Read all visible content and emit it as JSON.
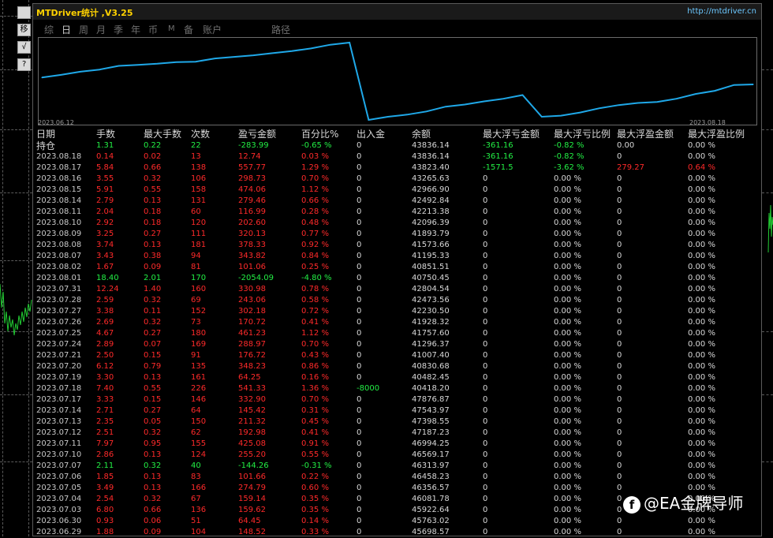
{
  "title": "MTDriver统计 ,V3.25",
  "url": "http://mtdriver.cn",
  "side_buttons": [
    "移",
    "√",
    "?"
  ],
  "tabs": [
    {
      "label": "综",
      "active": false
    },
    {
      "label": "日",
      "active": true
    },
    {
      "label": "周",
      "active": false
    },
    {
      "label": "月",
      "active": false
    },
    {
      "label": "季",
      "active": false
    },
    {
      "label": "年",
      "active": false
    },
    {
      "label": "币",
      "active": false
    },
    {
      "label": "M",
      "active": false
    },
    {
      "label": "备",
      "active": false
    },
    {
      "label": "账户",
      "active": false
    },
    {
      "label": "路径",
      "active": false
    }
  ],
  "chart_data": {
    "type": "line",
    "x_start_label": "2023.06.12",
    "x_end_label": "2023.08.18",
    "line_color": "#1fa8e8",
    "x": [
      "2023.06.12",
      "2023.06.19",
      "2023.06.26",
      "2023.06.29",
      "2023.06.30",
      "2023.07.03",
      "2023.07.04",
      "2023.07.05",
      "2023.07.06",
      "2023.07.07",
      "2023.07.10",
      "2023.07.11",
      "2023.07.12",
      "2023.07.13",
      "2023.07.14",
      "2023.07.17",
      "2023.07.18",
      "2023.07.19",
      "2023.07.20",
      "2023.07.21",
      "2023.07.24",
      "2023.07.25",
      "2023.07.26",
      "2023.07.27",
      "2023.07.28",
      "2023.07.31",
      "2023.08.01",
      "2023.08.02",
      "2023.08.07",
      "2023.08.08",
      "2023.08.09",
      "2023.08.10",
      "2023.08.11",
      "2023.08.14",
      "2023.08.15",
      "2023.08.16",
      "2023.08.17",
      "2023.08.18"
    ],
    "values": [
      44500,
      44750,
      45050,
      45250,
      45600,
      45700,
      45800,
      45950,
      46000,
      46300,
      46450,
      46600,
      46800,
      47000,
      47250,
      47600,
      47800,
      40500,
      40800,
      41000,
      41300,
      41750,
      41950,
      42250,
      42500,
      42850,
      40800,
      40900,
      41200,
      41600,
      41900,
      42100,
      42200,
      42500,
      42950,
      43250,
      43800,
      43850
    ]
  },
  "table": {
    "headers": [
      "日期",
      "手数",
      "最大手数",
      "次数",
      "盈亏金额",
      "百分比%",
      "出入金",
      "余额",
      "最大浮亏金额",
      "最大浮亏比例",
      "最大浮盈金额",
      "最大浮盈比例"
    ],
    "rows": [
      {
        "date": "持仓",
        "lots": "1.31",
        "max_lots": "0.22",
        "count": "22",
        "pl": "-283.99",
        "pct": "-0.65 %",
        "io": "0",
        "balance": "43836.14",
        "max_loss": "-361.16",
        "max_loss_pct": "-0.82 %",
        "max_gain": "0.00",
        "max_gain_pct": "0.00 %",
        "color": "g",
        "gain_color": "w"
      },
      {
        "date": "2023.08.18",
        "lots": "0.14",
        "max_lots": "0.02",
        "count": "13",
        "pl": "12.74",
        "pct": "0.03 %",
        "io": "0",
        "balance": "43836.14",
        "max_loss": "-361.16",
        "max_loss_pct": "-0.82 %",
        "max_gain": "0",
        "max_gain_pct": "0.00 %",
        "color": "r",
        "gain_color": "w"
      },
      {
        "date": "2023.08.17",
        "lots": "5.84",
        "max_lots": "0.66",
        "count": "138",
        "pl": "557.77",
        "pct": "1.29 %",
        "io": "0",
        "balance": "43823.40",
        "max_loss": "-1571.5",
        "max_loss_pct": "-3.62 %",
        "max_gain": "279.27",
        "max_gain_pct": "0.64 %",
        "color": "r",
        "gain_color": "r"
      },
      {
        "date": "2023.08.16",
        "lots": "3.55",
        "max_lots": "0.32",
        "count": "106",
        "pl": "298.73",
        "pct": "0.70 %",
        "io": "0",
        "balance": "43265.63",
        "max_loss": "0",
        "max_loss_pct": "0.00 %",
        "max_gain": "0",
        "max_gain_pct": "0.00 %",
        "color": "r",
        "gain_color": "w"
      },
      {
        "date": "2023.08.15",
        "lots": "5.91",
        "max_lots": "0.55",
        "count": "158",
        "pl": "474.06",
        "pct": "1.12 %",
        "io": "0",
        "balance": "42966.90",
        "max_loss": "0",
        "max_loss_pct": "0.00 %",
        "max_gain": "0",
        "max_gain_pct": "0.00 %",
        "color": "r",
        "gain_color": "w"
      },
      {
        "date": "2023.08.14",
        "lots": "2.79",
        "max_lots": "0.13",
        "count": "131",
        "pl": "279.46",
        "pct": "0.66 %",
        "io": "0",
        "balance": "42492.84",
        "max_loss": "0",
        "max_loss_pct": "0.00 %",
        "max_gain": "0",
        "max_gain_pct": "0.00 %",
        "color": "r",
        "gain_color": "w"
      },
      {
        "date": "2023.08.11",
        "lots": "2.04",
        "max_lots": "0.18",
        "count": "60",
        "pl": "116.99",
        "pct": "0.28 %",
        "io": "0",
        "balance": "42213.38",
        "max_loss": "0",
        "max_loss_pct": "0.00 %",
        "max_gain": "0",
        "max_gain_pct": "0.00 %",
        "color": "r",
        "gain_color": "w"
      },
      {
        "date": "2023.08.10",
        "lots": "2.92",
        "max_lots": "0.18",
        "count": "120",
        "pl": "202.60",
        "pct": "0.48 %",
        "io": "0",
        "balance": "42096.39",
        "max_loss": "0",
        "max_loss_pct": "0.00 %",
        "max_gain": "0",
        "max_gain_pct": "0.00 %",
        "color": "r",
        "gain_color": "w"
      },
      {
        "date": "2023.08.09",
        "lots": "3.25",
        "max_lots": "0.27",
        "count": "111",
        "pl": "320.13",
        "pct": "0.77 %",
        "io": "0",
        "balance": "41893.79",
        "max_loss": "0",
        "max_loss_pct": "0.00 %",
        "max_gain": "0",
        "max_gain_pct": "0.00 %",
        "color": "r",
        "gain_color": "w"
      },
      {
        "date": "2023.08.08",
        "lots": "3.74",
        "max_lots": "0.13",
        "count": "181",
        "pl": "378.33",
        "pct": "0.92 %",
        "io": "0",
        "balance": "41573.66",
        "max_loss": "0",
        "max_loss_pct": "0.00 %",
        "max_gain": "0",
        "max_gain_pct": "0.00 %",
        "color": "r",
        "gain_color": "w"
      },
      {
        "date": "2023.08.07",
        "lots": "3.43",
        "max_lots": "0.38",
        "count": "94",
        "pl": "343.82",
        "pct": "0.84 %",
        "io": "0",
        "balance": "41195.33",
        "max_loss": "0",
        "max_loss_pct": "0.00 %",
        "max_gain": "0",
        "max_gain_pct": "0.00 %",
        "color": "r",
        "gain_color": "w"
      },
      {
        "date": "2023.08.02",
        "lots": "1.67",
        "max_lots": "0.09",
        "count": "81",
        "pl": "101.06",
        "pct": "0.25 %",
        "io": "0",
        "balance": "40851.51",
        "max_loss": "0",
        "max_loss_pct": "0.00 %",
        "max_gain": "0",
        "max_gain_pct": "0.00 %",
        "color": "r",
        "gain_color": "w"
      },
      {
        "date": "2023.08.01",
        "lots": "18.40",
        "max_lots": "2.01",
        "count": "170",
        "pl": "-2054.09",
        "pct": "-4.80 %",
        "io": "0",
        "balance": "40750.45",
        "max_loss": "0",
        "max_loss_pct": "0.00 %",
        "max_gain": "0",
        "max_gain_pct": "0.00 %",
        "color": "g",
        "gain_color": "w"
      },
      {
        "date": "2023.07.31",
        "lots": "12.24",
        "max_lots": "1.40",
        "count": "160",
        "pl": "330.98",
        "pct": "0.78 %",
        "io": "0",
        "balance": "42804.54",
        "max_loss": "0",
        "max_loss_pct": "0.00 %",
        "max_gain": "0",
        "max_gain_pct": "0.00 %",
        "color": "r",
        "gain_color": "w"
      },
      {
        "date": "2023.07.28",
        "lots": "2.59",
        "max_lots": "0.32",
        "count": "69",
        "pl": "243.06",
        "pct": "0.58 %",
        "io": "0",
        "balance": "42473.56",
        "max_loss": "0",
        "max_loss_pct": "0.00 %",
        "max_gain": "0",
        "max_gain_pct": "0.00 %",
        "color": "r",
        "gain_color": "w"
      },
      {
        "date": "2023.07.27",
        "lots": "3.38",
        "max_lots": "0.11",
        "count": "152",
        "pl": "302.18",
        "pct": "0.72 %",
        "io": "0",
        "balance": "42230.50",
        "max_loss": "0",
        "max_loss_pct": "0.00 %",
        "max_gain": "0",
        "max_gain_pct": "0.00 %",
        "color": "r",
        "gain_color": "w"
      },
      {
        "date": "2023.07.26",
        "lots": "2.69",
        "max_lots": "0.32",
        "count": "73",
        "pl": "170.72",
        "pct": "0.41 %",
        "io": "0",
        "balance": "41928.32",
        "max_loss": "0",
        "max_loss_pct": "0.00 %",
        "max_gain": "0",
        "max_gain_pct": "0.00 %",
        "color": "r",
        "gain_color": "w"
      },
      {
        "date": "2023.07.25",
        "lots": "4.67",
        "max_lots": "0.27",
        "count": "180",
        "pl": "461.23",
        "pct": "1.12 %",
        "io": "0",
        "balance": "41757.60",
        "max_loss": "0",
        "max_loss_pct": "0.00 %",
        "max_gain": "0",
        "max_gain_pct": "0.00 %",
        "color": "r",
        "gain_color": "w"
      },
      {
        "date": "2023.07.24",
        "lots": "2.89",
        "max_lots": "0.07",
        "count": "169",
        "pl": "288.97",
        "pct": "0.70 %",
        "io": "0",
        "balance": "41296.37",
        "max_loss": "0",
        "max_loss_pct": "0.00 %",
        "max_gain": "0",
        "max_gain_pct": "0.00 %",
        "color": "r",
        "gain_color": "w"
      },
      {
        "date": "2023.07.21",
        "lots": "2.50",
        "max_lots": "0.15",
        "count": "91",
        "pl": "176.72",
        "pct": "0.43 %",
        "io": "0",
        "balance": "41007.40",
        "max_loss": "0",
        "max_loss_pct": "0.00 %",
        "max_gain": "0",
        "max_gain_pct": "0.00 %",
        "color": "r",
        "gain_color": "w"
      },
      {
        "date": "2023.07.20",
        "lots": "6.12",
        "max_lots": "0.79",
        "count": "135",
        "pl": "348.23",
        "pct": "0.86 %",
        "io": "0",
        "balance": "40830.68",
        "max_loss": "0",
        "max_loss_pct": "0.00 %",
        "max_gain": "0",
        "max_gain_pct": "0.00 %",
        "color": "r",
        "gain_color": "w"
      },
      {
        "date": "2023.07.19",
        "lots": "3.30",
        "max_lots": "0.13",
        "count": "161",
        "pl": "64.25",
        "pct": "0.16 %",
        "io": "0",
        "balance": "40482.45",
        "max_loss": "0",
        "max_loss_pct": "0.00 %",
        "max_gain": "0",
        "max_gain_pct": "0.00 %",
        "color": "r",
        "gain_color": "w"
      },
      {
        "date": "2023.07.18",
        "lots": "7.40",
        "max_lots": "0.55",
        "count": "226",
        "pl": "541.33",
        "pct": "1.36 %",
        "io": "-8000",
        "balance": "40418.20",
        "max_loss": "0",
        "max_loss_pct": "0.00 %",
        "max_gain": "0",
        "max_gain_pct": "0.00 %",
        "color": "r",
        "gain_color": "w",
        "io_color": "g"
      },
      {
        "date": "2023.07.17",
        "lots": "3.33",
        "max_lots": "0.15",
        "count": "146",
        "pl": "332.90",
        "pct": "0.70 %",
        "io": "0",
        "balance": "47876.87",
        "max_loss": "0",
        "max_loss_pct": "0.00 %",
        "max_gain": "0",
        "max_gain_pct": "0.00 %",
        "color": "r",
        "gain_color": "w"
      },
      {
        "date": "2023.07.14",
        "lots": "2.71",
        "max_lots": "0.27",
        "count": "64",
        "pl": "145.42",
        "pct": "0.31 %",
        "io": "0",
        "balance": "47543.97",
        "max_loss": "0",
        "max_loss_pct": "0.00 %",
        "max_gain": "0",
        "max_gain_pct": "0.00 %",
        "color": "r",
        "gain_color": "w"
      },
      {
        "date": "2023.07.13",
        "lots": "2.35",
        "max_lots": "0.05",
        "count": "150",
        "pl": "211.32",
        "pct": "0.45 %",
        "io": "0",
        "balance": "47398.55",
        "max_loss": "0",
        "max_loss_pct": "0.00 %",
        "max_gain": "0",
        "max_gain_pct": "0.00 %",
        "color": "r",
        "gain_color": "w"
      },
      {
        "date": "2023.07.12",
        "lots": "2.51",
        "max_lots": "0.32",
        "count": "62",
        "pl": "192.98",
        "pct": "0.41 %",
        "io": "0",
        "balance": "47187.23",
        "max_loss": "0",
        "max_loss_pct": "0.00 %",
        "max_gain": "0",
        "max_gain_pct": "0.00 %",
        "color": "r",
        "gain_color": "w"
      },
      {
        "date": "2023.07.11",
        "lots": "7.97",
        "max_lots": "0.95",
        "count": "155",
        "pl": "425.08",
        "pct": "0.91 %",
        "io": "0",
        "balance": "46994.25",
        "max_loss": "0",
        "max_loss_pct": "0.00 %",
        "max_gain": "0",
        "max_gain_pct": "0.00 %",
        "color": "r",
        "gain_color": "w"
      },
      {
        "date": "2023.07.10",
        "lots": "2.86",
        "max_lots": "0.13",
        "count": "124",
        "pl": "255.20",
        "pct": "0.55 %",
        "io": "0",
        "balance": "46569.17",
        "max_loss": "0",
        "max_loss_pct": "0.00 %",
        "max_gain": "0",
        "max_gain_pct": "0.00 %",
        "color": "r",
        "gain_color": "w"
      },
      {
        "date": "2023.07.07",
        "lots": "2.11",
        "max_lots": "0.32",
        "count": "40",
        "pl": "-144.26",
        "pct": "-0.31 %",
        "io": "0",
        "balance": "46313.97",
        "max_loss": "0",
        "max_loss_pct": "0.00 %",
        "max_gain": "0",
        "max_gain_pct": "0.00 %",
        "color": "g",
        "gain_color": "w"
      },
      {
        "date": "2023.07.06",
        "lots": "1.85",
        "max_lots": "0.13",
        "count": "83",
        "pl": "101.66",
        "pct": "0.22 %",
        "io": "0",
        "balance": "46458.23",
        "max_loss": "0",
        "max_loss_pct": "0.00 %",
        "max_gain": "0",
        "max_gain_pct": "0.00 %",
        "color": "r",
        "gain_color": "w"
      },
      {
        "date": "2023.07.05",
        "lots": "3.49",
        "max_lots": "0.13",
        "count": "166",
        "pl": "274.79",
        "pct": "0.60 %",
        "io": "0",
        "balance": "46356.57",
        "max_loss": "0",
        "max_loss_pct": "0.00 %",
        "max_gain": "0",
        "max_gain_pct": "0.00 %",
        "color": "r",
        "gain_color": "w"
      },
      {
        "date": "2023.07.04",
        "lots": "2.54",
        "max_lots": "0.32",
        "count": "67",
        "pl": "159.14",
        "pct": "0.35 %",
        "io": "0",
        "balance": "46081.78",
        "max_loss": "0",
        "max_loss_pct": "0.00 %",
        "max_gain": "0",
        "max_gain_pct": "0.00 %",
        "color": "r",
        "gain_color": "w"
      },
      {
        "date": "2023.07.03",
        "lots": "6.80",
        "max_lots": "0.66",
        "count": "136",
        "pl": "159.62",
        "pct": "0.35 %",
        "io": "0",
        "balance": "45922.64",
        "max_loss": "0",
        "max_loss_pct": "0.00 %",
        "max_gain": "0",
        "max_gain_pct": "0.00 %",
        "color": "r",
        "gain_color": "w"
      },
      {
        "date": "2023.06.30",
        "lots": "0.93",
        "max_lots": "0.06",
        "count": "51",
        "pl": "64.45",
        "pct": "0.14 %",
        "io": "0",
        "balance": "45763.02",
        "max_loss": "0",
        "max_loss_pct": "0.00 %",
        "max_gain": "0",
        "max_gain_pct": "0.00 %",
        "color": "r",
        "gain_color": "w"
      },
      {
        "date": "2023.06.29",
        "lots": "1.88",
        "max_lots": "0.09",
        "count": "104",
        "pl": "148.52",
        "pct": "0.33 %",
        "io": "0",
        "balance": "45698.57",
        "max_loss": "0",
        "max_loss_pct": "0.00 %",
        "max_gain": "0",
        "max_gain_pct": "0.00 %",
        "color": "r",
        "gain_color": "w"
      }
    ]
  },
  "watermark": "@EA金牌导师",
  "watermark_icon": "facebook-f-icon"
}
